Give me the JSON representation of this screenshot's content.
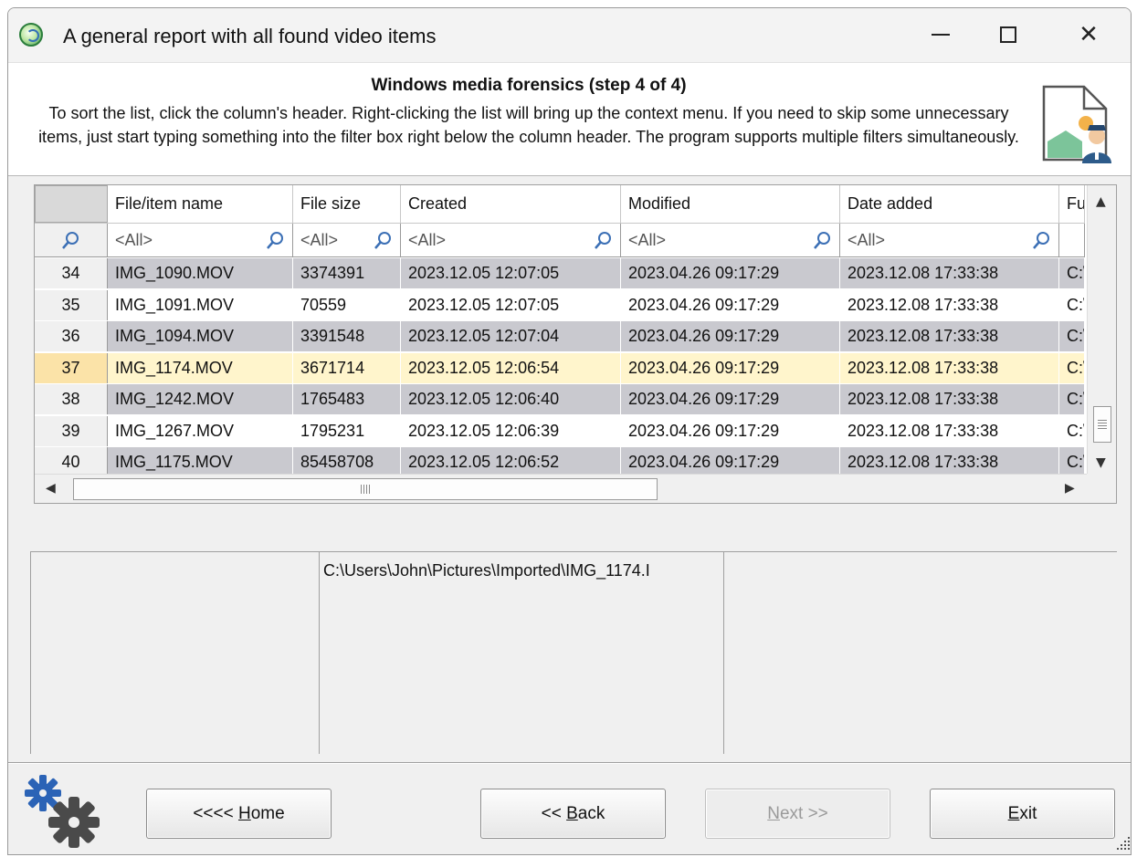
{
  "window": {
    "title": "A general report with all found video items",
    "controls": {
      "minimize": "minimize",
      "maximize": "maximize",
      "close": "✕"
    }
  },
  "header": {
    "step_title": "Windows media forensics (step 4 of 4)",
    "description": "To sort the list, click the column's header. Right-clicking the list will bring up the context menu. If you need to skip some unnecessary items, just start typing something into the filter box right below the column header. The program supports multiple filters simultaneously.",
    "icon": "document-investigator-icon"
  },
  "grid": {
    "columns": [
      "",
      "File/item name",
      "File size",
      "Created",
      "Modified",
      "Date added",
      "Fu"
    ],
    "filter_placeholder": "<All>",
    "rows": [
      {
        "num": "34",
        "name": "IMG_1090.MOV",
        "size": "3374391",
        "created": "2023.12.05 12:07:05",
        "modified": "2023.04.26 09:17:29",
        "added": "2023.12.08 17:33:38",
        "full": "C:\\"
      },
      {
        "num": "35",
        "name": "IMG_1091.MOV",
        "size": "70559",
        "created": "2023.12.05 12:07:05",
        "modified": "2023.04.26 09:17:29",
        "added": "2023.12.08 17:33:38",
        "full": "C:\\"
      },
      {
        "num": "36",
        "name": "IMG_1094.MOV",
        "size": "3391548",
        "created": "2023.12.05 12:07:04",
        "modified": "2023.04.26 09:17:29",
        "added": "2023.12.08 17:33:38",
        "full": "C:\\"
      },
      {
        "num": "37",
        "name": "IMG_1174.MOV",
        "size": "3671714",
        "created": "2023.12.05 12:06:54",
        "modified": "2023.04.26 09:17:29",
        "added": "2023.12.08 17:33:38",
        "full": "C:\\"
      },
      {
        "num": "38",
        "name": "IMG_1242.MOV",
        "size": "1765483",
        "created": "2023.12.05 12:06:40",
        "modified": "2023.04.26 09:17:29",
        "added": "2023.12.08 17:33:38",
        "full": "C:\\"
      },
      {
        "num": "39",
        "name": "IMG_1267.MOV",
        "size": "1795231",
        "created": "2023.12.05 12:06:39",
        "modified": "2023.04.26 09:17:29",
        "added": "2023.12.08 17:33:38",
        "full": "C:\\"
      },
      {
        "num": "40",
        "name": "IMG_1175.MOV",
        "size": "85458708",
        "created": "2023.12.05 12:06:52",
        "modified": "2023.04.26 09:17:29",
        "added": "2023.12.08 17:33:38",
        "full": "C:\\"
      }
    ],
    "selected_row": "37"
  },
  "details": {
    "path": "C:\\Users\\John\\Pictures\\Imported\\IMG_1174.I"
  },
  "buttons": {
    "home": {
      "prefix": "<<<< ",
      "accel": "H",
      "rest": "ome"
    },
    "back": {
      "prefix": "<< ",
      "accel": "B",
      "rest": "ack"
    },
    "next": {
      "accel": "N",
      "rest": "ext >>"
    },
    "exit": {
      "accel": "E",
      "rest": "xit"
    }
  }
}
